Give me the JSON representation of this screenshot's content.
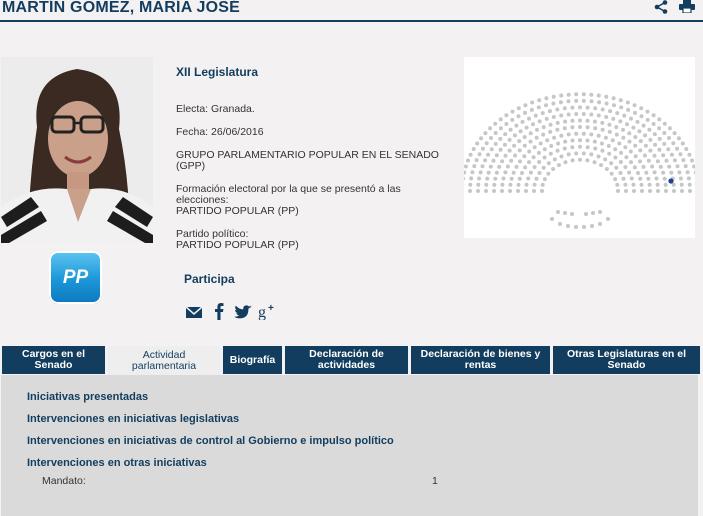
{
  "header": {
    "name": "MARTÍN GÓMEZ, MARÍA JOSÉ"
  },
  "profile": {
    "legislature": "XII Legislatura",
    "elected": "Electa: Granada.",
    "date": "Fecha: 26/06/2016",
    "group_line1": "GRUPO PARLAMENTARIO POPULAR EN EL SENADO",
    "group_line2": "(GPP)",
    "formation_label_line1": "Formación electoral por la que se presentó a las",
    "formation_label_line2": "elecciones:",
    "formation_value": "PARTIDO POPULAR (PP)",
    "party_label": "Partido político:",
    "party_value": "PARTIDO POPULAR (PP)",
    "logo_text": "PP",
    "participa": "Participa"
  },
  "social_icons": [
    "mail-icon",
    "facebook-icon",
    "twitter-icon",
    "google-plus-icon"
  ],
  "colors": {
    "navy": "#123d5e",
    "seat_default": "#c4c6c8",
    "seat_highlight": "#1f3f9a",
    "logo_blue": "#1b96d8"
  },
  "tabs": [
    {
      "line1": "Cargos en el",
      "line2": "Senado",
      "active": false
    },
    {
      "line1": "Actividad",
      "line2": "parlamentaria",
      "active": true
    },
    {
      "line1": "Biografía",
      "line2": "",
      "active": false
    },
    {
      "line1": "Declaración de",
      "line2": "actividades",
      "active": false
    },
    {
      "line1": "Declaración de bienes y",
      "line2": "rentas",
      "active": false
    },
    {
      "line1": "Otras Legislaturas en el",
      "line2": "Senado",
      "active": false
    }
  ],
  "panel": {
    "links": [
      "Iniciativas presentadas",
      "Intervenciones en iniciativas legislativas",
      "Intervenciones en iniciativas de control al Gobierno e impulso político",
      "Intervenciones en otras iniciativas"
    ],
    "mandato_label": "Mandato:",
    "mandato_value": "1"
  }
}
